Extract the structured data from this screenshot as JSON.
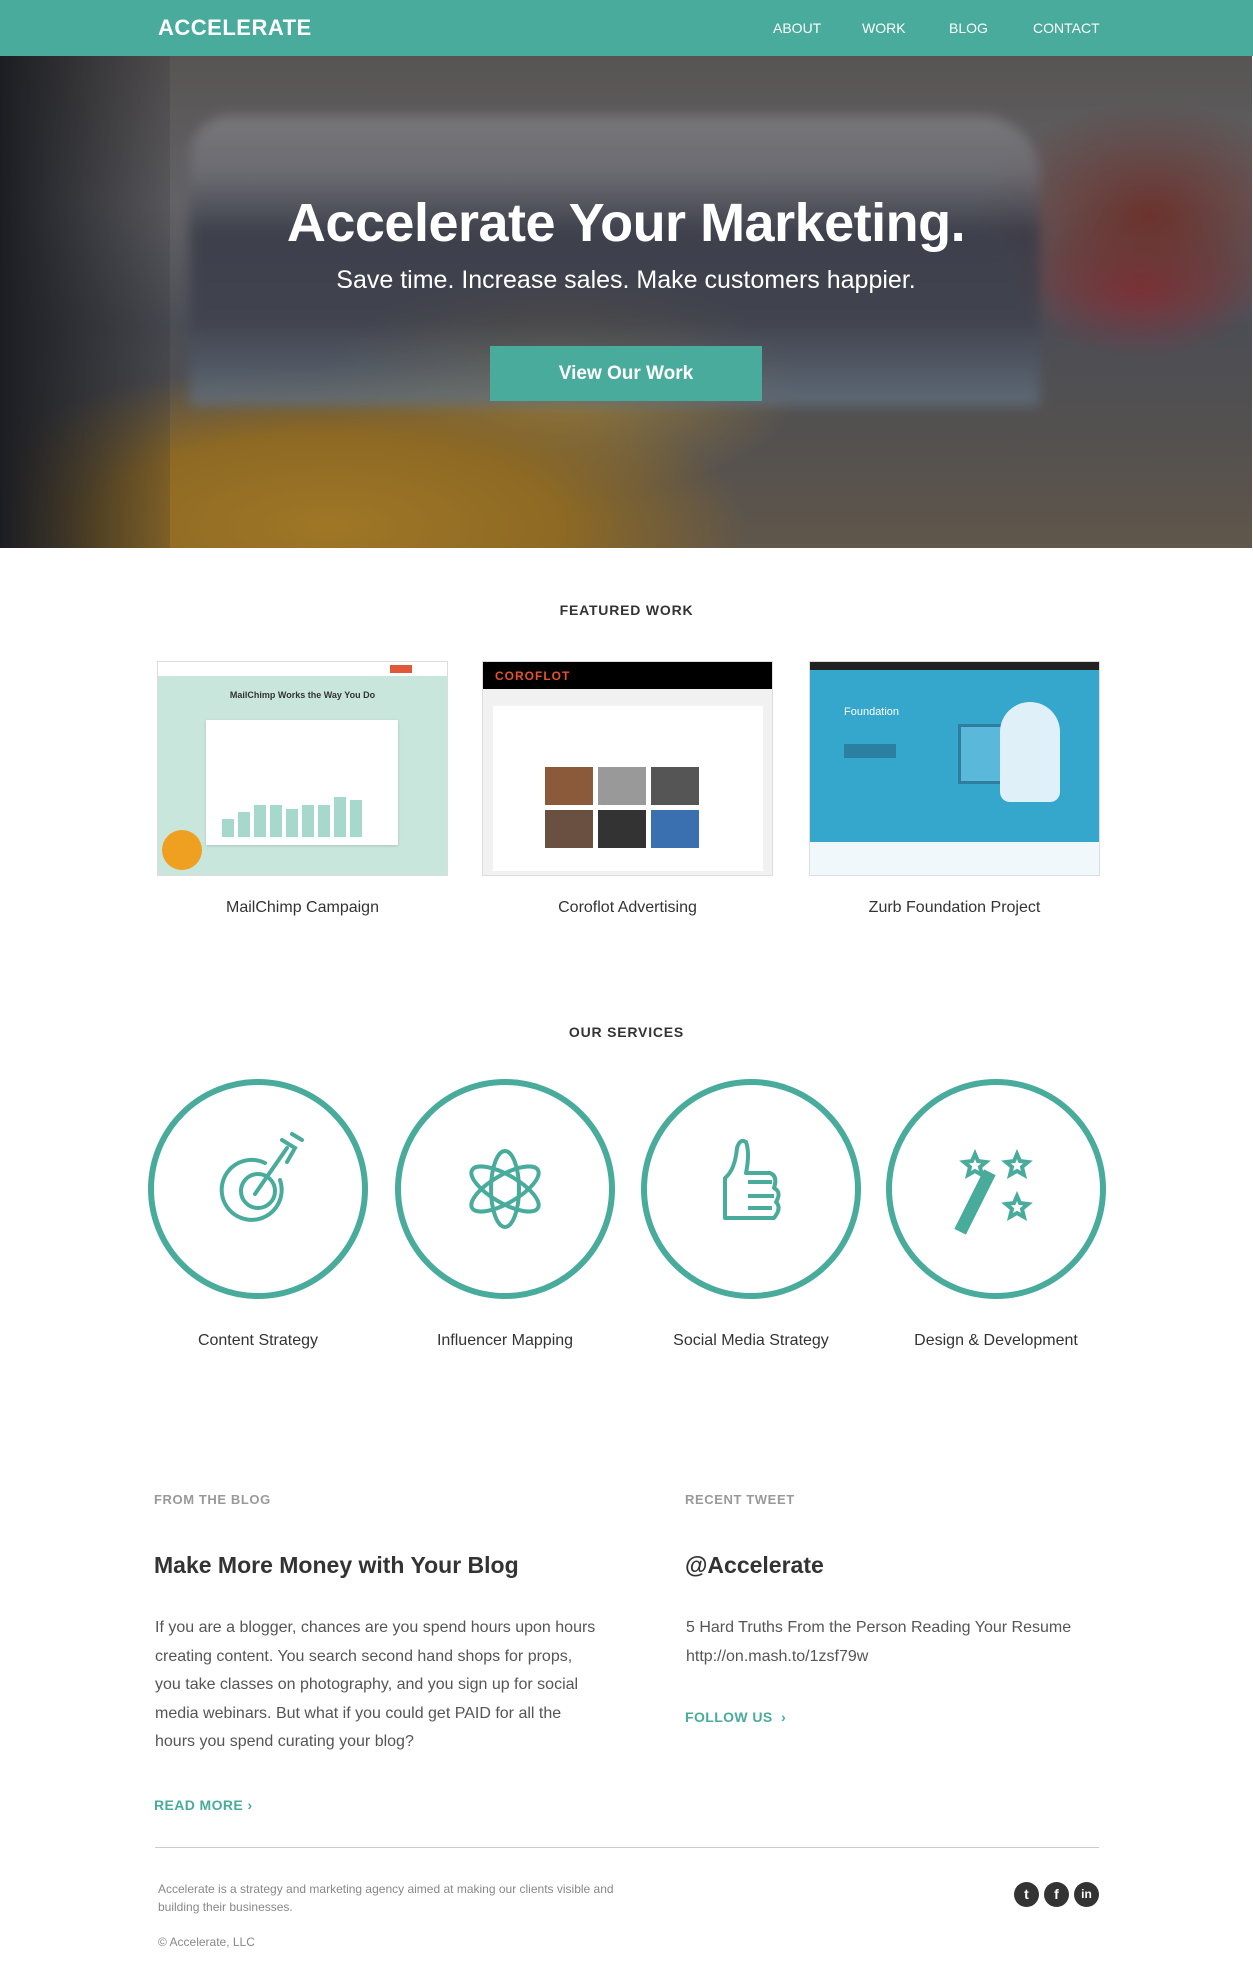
{
  "nav": {
    "logo": "ACCELERATE",
    "links": [
      "ABOUT",
      "WORK",
      "BLOG",
      "CONTACT"
    ]
  },
  "hero": {
    "title": "Accelerate Your Marketing.",
    "subtitle": "Save time. Increase sales. Make customers happier.",
    "cta": "View Our Work"
  },
  "featured": {
    "title": "FEATURED WORK",
    "items": [
      {
        "caption": "MailChimp Campaign",
        "thumb_text": "MailChimp Works the Way You Do"
      },
      {
        "caption": "Coroflot Advertising",
        "thumb_text": "COROFLOT"
      },
      {
        "caption": "Zurb Foundation Project",
        "thumb_text": "Foundation"
      }
    ]
  },
  "services": {
    "title": "OUR SERVICES",
    "accent": "#48ab9b",
    "items": [
      {
        "label": "Content Strategy",
        "icon": "target-arrow-icon"
      },
      {
        "label": "Influencer Mapping",
        "icon": "atom-icon"
      },
      {
        "label": "Social Media Strategy",
        "icon": "thumbs-up-icon"
      },
      {
        "label": "Design & Development",
        "icon": "magic-wand-icon"
      }
    ]
  },
  "blog": {
    "kicker": "FROM THE BLOG",
    "title": "Make More Money with Your Blog",
    "body": "If you are a blogger, chances are you spend hours upon hours creating content. You search second hand shops for props, you take classes on photography, and you sign up for social media webinars. But what if you could get PAID for all the hours you spend curating your blog?",
    "link": "READ MORE ›"
  },
  "tweet": {
    "kicker": "RECENT TWEET",
    "handle": "@Accelerate",
    "text": "5 Hard Truths From the Person Reading Your Resume",
    "url": "http://on.mash.to/1zsf79w",
    "link": "FOLLOW US  ›"
  },
  "footer": {
    "about": "Accelerate is a strategy and marketing agency aimed at making our clients visible and building their businesses.",
    "copyright": "© Accelerate, LLC",
    "social": [
      "twitter-icon",
      "facebook-icon",
      "linkedin-icon"
    ]
  }
}
